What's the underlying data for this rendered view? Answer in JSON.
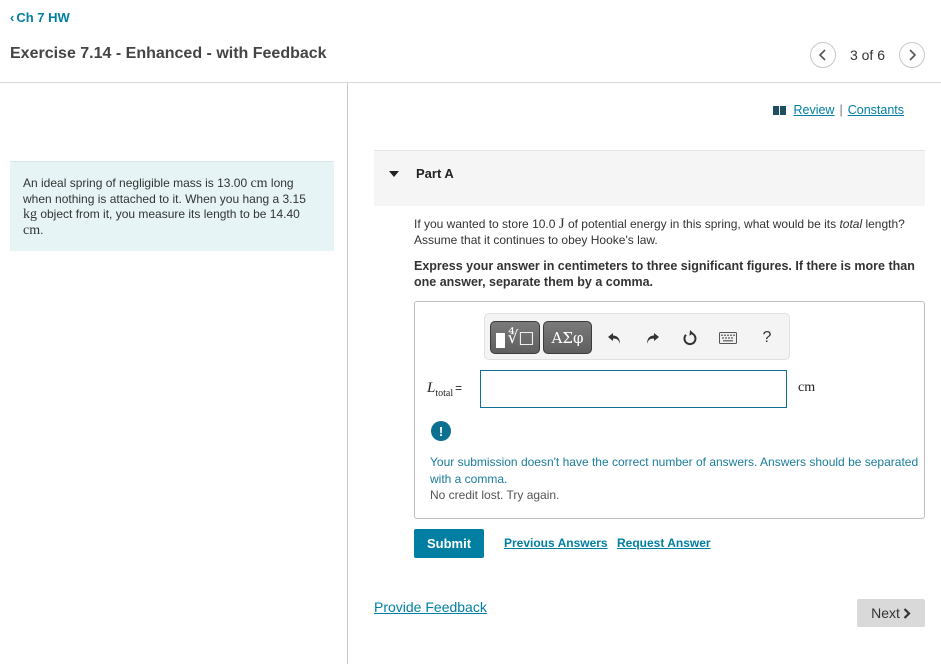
{
  "nav": {
    "back_label": "Ch 7 HW",
    "back_icon": "chevron-left-icon",
    "title": "Exercise 7.14 - Enhanced - with Feedback",
    "pager": {
      "current": 3,
      "total": 6,
      "label": "3 of 6"
    }
  },
  "problem": {
    "text_1": "An ideal spring of negligible mass is 13.00 ",
    "unit_1": "cm",
    "text_2": " long when nothing is attached to it. When you hang a 3.15 ",
    "unit_2": "kg",
    "text_3": "  object from it, you measure its length to be 14.40 ",
    "unit_3": "cm",
    "text_4": "."
  },
  "resources": {
    "review_label": "Review",
    "separator": "|",
    "constants_label": "Constants"
  },
  "part": {
    "label": "Part A",
    "question_1": "If you wanted to store 10.0 ",
    "question_unit": "J",
    "question_2": " of potential energy in this spring, what would be its ",
    "question_em": "total",
    "question_3": " length? Assume that it continues to obey Hooke's law.",
    "instructions": "Express your answer in centimeters to three significant figures. If there is more than one answer, separate them by a comma."
  },
  "toolbar": {
    "templates_icon": "templates-icon",
    "greek_label": "ΑΣφ",
    "undo_icon": "undo-icon",
    "redo_icon": "redo-icon",
    "reset_icon": "reset-icon",
    "keyboard_icon": "keyboard-icon",
    "help_label": "?"
  },
  "answer": {
    "variable": "L",
    "subscript": "total",
    "equals": "=",
    "value": "",
    "unit": "cm"
  },
  "feedback": {
    "icon": "!",
    "message": "Your submission doesn't have the correct number of answers. Answers should be separated with a comma.",
    "note": "No credit lost. Try again."
  },
  "actions": {
    "submit_label": "Submit",
    "previous_answers_label": "Previous Answers",
    "request_answer_label": "Request Answer"
  },
  "footer": {
    "provide_feedback_label": "Provide Feedback",
    "next_label": "Next"
  },
  "colors": {
    "accent": "#007fa3",
    "problem_bg": "#e6f4f6",
    "part_header_bg": "#f5f5f5",
    "feedback_text": "#1a7d9c",
    "next_bg": "#d9d9d9"
  }
}
